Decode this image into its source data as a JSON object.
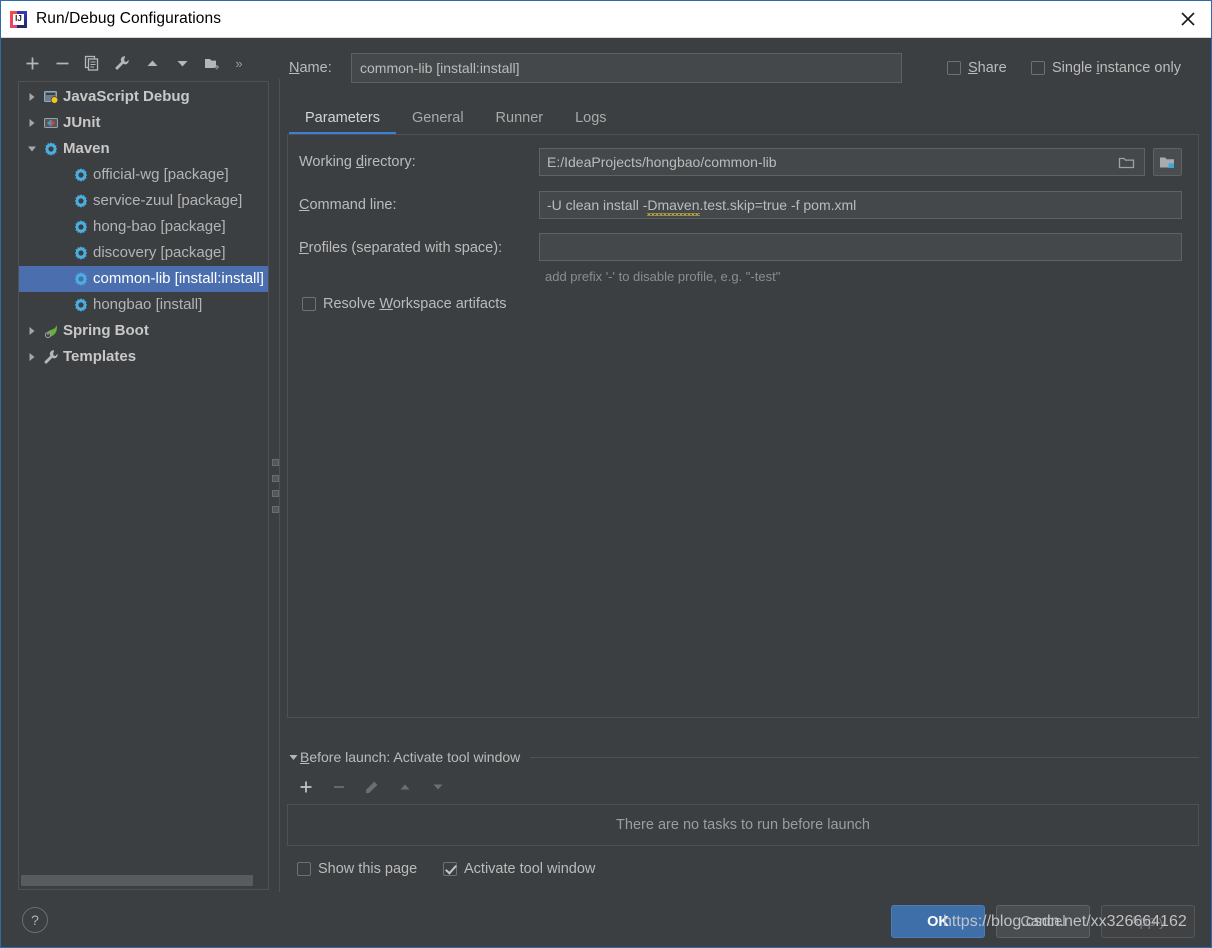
{
  "window": {
    "title": "Run/Debug Configurations",
    "app_icon": "intellij-idea-icon",
    "close_icon": "close-icon"
  },
  "colors": {
    "background": "#3c3f41",
    "field_background": "#45484a",
    "selection_blue": "#4b6eaf",
    "accent_blue": "#3d7fd6",
    "ok_button_blue": "#3f6fa8",
    "text": "#bbbbbb",
    "titlebar_background": "#ffffff"
  },
  "tree_toolbar": {
    "buttons": [
      {
        "name": "add-configuration-button",
        "icon": "plus-icon",
        "enabled": true
      },
      {
        "name": "remove-configuration-button",
        "icon": "minus-icon",
        "enabled": true
      },
      {
        "name": "copy-configuration-button",
        "icon": "copy-icon",
        "enabled": true
      },
      {
        "name": "edit-templates-button",
        "icon": "wrench-icon",
        "enabled": true
      },
      {
        "name": "move-up-button",
        "icon": "arrow-up-icon",
        "enabled": true
      },
      {
        "name": "move-down-button",
        "icon": "arrow-down-icon",
        "enabled": true
      },
      {
        "name": "new-folder-button",
        "icon": "new-folder-icon",
        "enabled": true
      }
    ],
    "overflow_label": "»"
  },
  "tree": {
    "items": [
      {
        "label": "JavaScript Debug",
        "icon": "javascript-debug-icon",
        "level": "group",
        "expanded": false,
        "selected": false
      },
      {
        "label": "JUnit",
        "icon": "junit-icon",
        "level": "group",
        "expanded": false,
        "selected": false
      },
      {
        "label": "Maven",
        "icon": "maven-icon",
        "level": "group",
        "expanded": true,
        "selected": false
      },
      {
        "label": "official-wg [package]",
        "icon": "maven-icon",
        "level": "child",
        "selected": false
      },
      {
        "label": "service-zuul [package]",
        "icon": "maven-icon",
        "level": "child",
        "selected": false
      },
      {
        "label": "hong-bao [package]",
        "icon": "maven-icon",
        "level": "child",
        "selected": false
      },
      {
        "label": "discovery [package]",
        "icon": "maven-icon",
        "level": "child",
        "selected": false
      },
      {
        "label": "common-lib [install:install]",
        "icon": "maven-icon",
        "level": "child",
        "selected": true
      },
      {
        "label": "hongbao [install]",
        "icon": "maven-icon",
        "level": "child",
        "selected": false
      },
      {
        "label": "Spring Boot",
        "icon": "spring-boot-icon",
        "level": "group",
        "expanded": false,
        "selected": false
      },
      {
        "label": "Templates",
        "icon": "wrench-icon",
        "level": "group",
        "expanded": false,
        "selected": false
      }
    ]
  },
  "name_row": {
    "label": "Name:",
    "label_mnemonic": "N",
    "value": "common-lib [install:install]",
    "placeholder": ""
  },
  "options": {
    "share": {
      "label": "Share",
      "mnemonic": "S",
      "checked": false
    },
    "single_instance": {
      "label": "Single instance only",
      "mnemonic": "i",
      "checked": false
    }
  },
  "tabs": [
    {
      "label": "Parameters",
      "active": true
    },
    {
      "label": "General",
      "active": false
    },
    {
      "label": "Runner",
      "active": false
    },
    {
      "label": "Logs",
      "active": false
    }
  ],
  "parameters": {
    "working_directory": {
      "label": "Working directory:",
      "mnemonic": "d",
      "value": "E:/IdeaProjects/hongbao/common-lib",
      "placeholder": "",
      "inner_browse_icon": "folder-outline-icon",
      "outer_browse_icon": "folder-module-icon"
    },
    "command_line": {
      "label": "Command line:",
      "mnemonic": "C",
      "value_prefix": "-U clean install -",
      "value_misspelled": "Dmaven",
      "value_suffix": ".test.skip=true -f pom.xml",
      "full_value": "-U clean install -Dmaven.test.skip=true -f pom.xml",
      "placeholder": ""
    },
    "profiles": {
      "label": "Profiles (separated with space):",
      "mnemonic": "P",
      "value": "",
      "placeholder": "",
      "hint": "add prefix '-' to disable profile, e.g. \"-test\""
    },
    "resolve_workspace": {
      "label": "Resolve Workspace artifacts",
      "mnemonic": "W",
      "checked": false
    }
  },
  "before_launch": {
    "title": "Before launch: Activate tool window",
    "mnemonic": "B",
    "collapse_icon": "triangle-down-icon",
    "toolbar": [
      {
        "name": "add-task-button",
        "icon": "plus-icon",
        "enabled": true
      },
      {
        "name": "remove-task-button",
        "icon": "minus-icon",
        "enabled": false
      },
      {
        "name": "edit-task-button",
        "icon": "pencil-icon",
        "enabled": false
      },
      {
        "name": "move-task-up-button",
        "icon": "arrow-up-icon",
        "enabled": false
      },
      {
        "name": "move-task-down-button",
        "icon": "arrow-down-icon",
        "enabled": false
      }
    ],
    "empty_message": "There are no tasks to run before launch",
    "show_this_page": {
      "label": "Show this page",
      "checked": false
    },
    "activate_tool_window": {
      "label": "Activate tool window",
      "checked": true
    }
  },
  "footer": {
    "help_label": "?",
    "ok_label": "OK",
    "cancel_label": "Cancel",
    "apply_label": "Apply"
  },
  "watermark": {
    "text": "https://blog.csdn.net/xx326664162"
  }
}
